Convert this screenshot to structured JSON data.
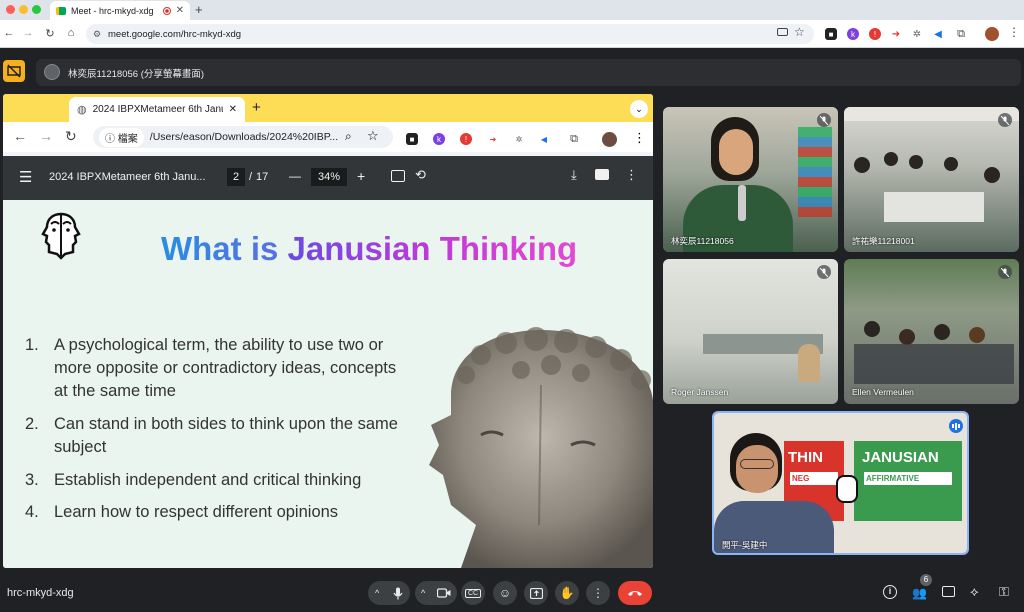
{
  "browser": {
    "tab_title": "Meet - hrc-mkyd-xdg",
    "url": "meet.google.com/hrc-mkyd-xdg"
  },
  "meet": {
    "presenting_label": "林奕辰11218056 (分享螢幕畫面)",
    "meeting_code": "hrc-mkyd-xdg",
    "participant_count": "6",
    "participants": [
      {
        "name": "林奕辰11218056"
      },
      {
        "name": "許祐樂11218001"
      },
      {
        "name": "Roger Janssen"
      },
      {
        "name": "Ellen Vermeulen"
      },
      {
        "name": "開平-吳建中"
      }
    ]
  },
  "shared_screen": {
    "tab_title": "2024 IBPXMetameer 6th Janu",
    "omnibox_chip": "檔案",
    "omnibox_path": "/Users/eason/Downloads/2024%20IBP...",
    "pdf": {
      "title": "2024 IBPXMetameer 6th Janu...",
      "page": "2",
      "page_sep": "/",
      "total_pages": "17",
      "zoom": "34%",
      "minus": "—",
      "plus": "+"
    },
    "slide": {
      "title_part1": "What is",
      "title_part2": "Janusian Thinking",
      "points": [
        {
          "num": "1.",
          "text": "A psychological term, the ability to use two or more opposite or contradictory ideas, concepts at the same time"
        },
        {
          "num": "2.",
          "text": "Can stand in both sides to think upon the same subject"
        },
        {
          "num": "3.",
          "text": "Establish independent and critical thinking"
        },
        {
          "num": "4.",
          "text": "Learn how to respect different opinions"
        }
      ]
    }
  },
  "banner": {
    "left": "THIN",
    "left_sub": "NEG",
    "right": "JANUSIAN",
    "right_sub": "AFFIRMATIVE"
  },
  "colors": {
    "accent_yellow": "#f6b01e",
    "end_call_red": "#ea4335",
    "active_speaker_blue": "#8ab4f8"
  }
}
